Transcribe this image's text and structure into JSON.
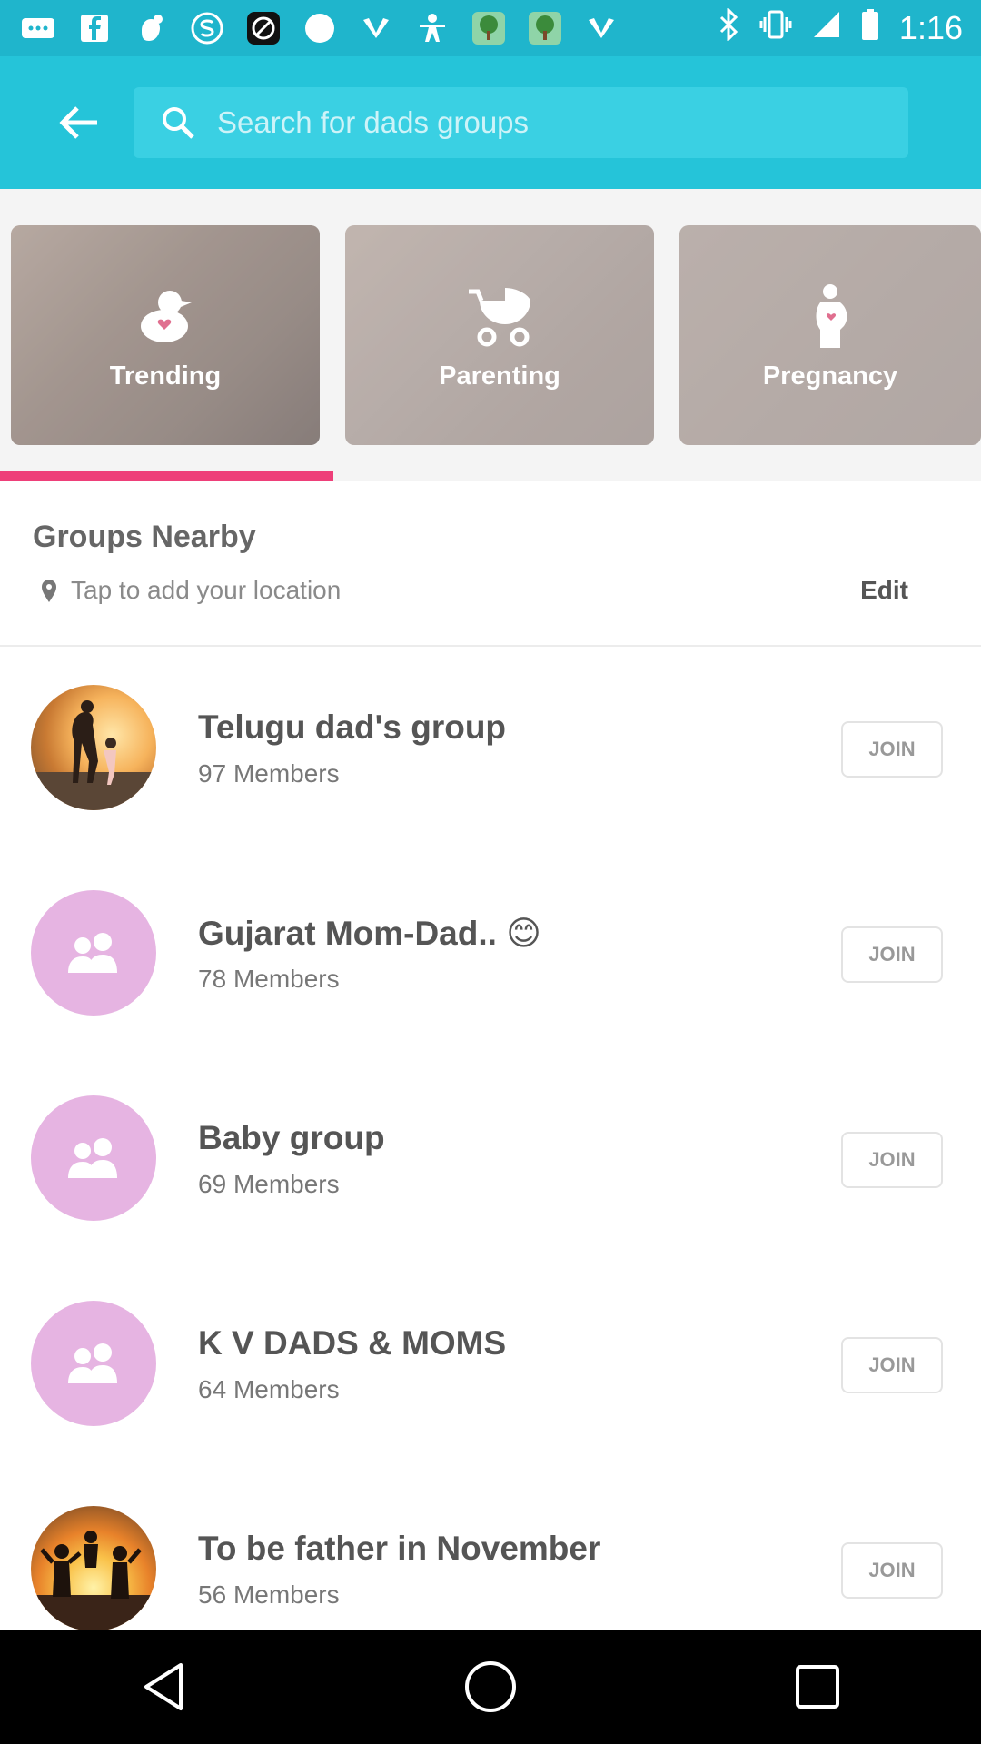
{
  "status_bar": {
    "time": "1:16",
    "icons": [
      "message-icon",
      "facebook-icon",
      "hand-icon",
      "s-icon",
      "no-sign-icon",
      "circle-icon",
      "fan-icon",
      "person-icon",
      "tree-icon",
      "tree-icon",
      "fan-icon",
      "bluetooth-icon",
      "vibrate-icon",
      "signal-icon",
      "battery-icon"
    ]
  },
  "toolbar": {
    "back_icon": "back-arrow-icon",
    "search_placeholder": "Search for dads groups"
  },
  "categories": [
    {
      "label": "Trending",
      "icon": "duck-icon"
    },
    {
      "label": "Parenting",
      "icon": "stroller-icon"
    },
    {
      "label": "Pregnancy",
      "icon": "pregnant-icon"
    }
  ],
  "selected_category_index": 0,
  "colors": {
    "toolbar": "#25c4d9",
    "status_bar": "#1fb5cc",
    "accent": "#ee3f79",
    "avatar_plain": "#e6b4e2"
  },
  "nearby": {
    "title": "Groups Nearby",
    "location_text": "Tap to add your location",
    "edit_label": "Edit"
  },
  "groups": [
    {
      "name": "Telugu dad's group",
      "count": "97",
      "members_label": "Members",
      "join_label": "JOIN",
      "avatar": "photo"
    },
    {
      "name": "Gujarat Mom-Dad.. 😊",
      "count": "78",
      "members_label": "Members",
      "join_label": "JOIN",
      "avatar": "group-icon"
    },
    {
      "name": "Baby group",
      "count": "69",
      "members_label": "Members",
      "join_label": "JOIN",
      "avatar": "group-icon"
    },
    {
      "name": "K V DADS & MOMS",
      "count": "64",
      "members_label": "Members",
      "join_label": "JOIN",
      "avatar": "group-icon"
    },
    {
      "name": "To be father in November",
      "count": "56",
      "members_label": "Members",
      "join_label": "JOIN",
      "avatar": "photo"
    }
  ]
}
